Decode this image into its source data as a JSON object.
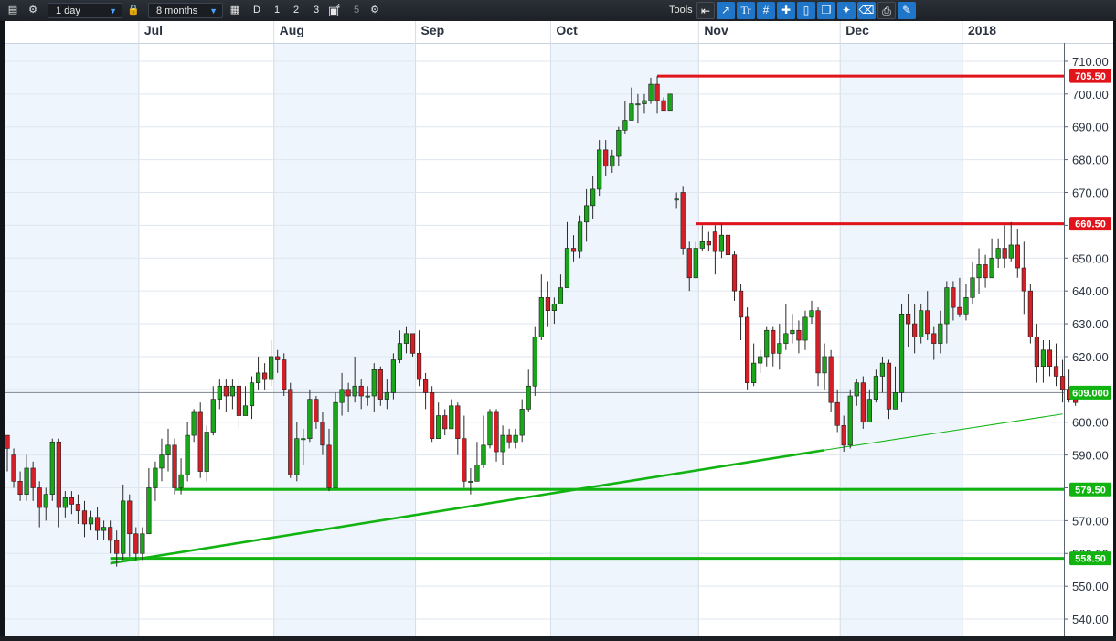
{
  "toolbar": {
    "interval": "1 day",
    "range": "8 months",
    "period_d": "D",
    "n1": "1",
    "n2": "2",
    "n3": "3",
    "n4_badge": "4",
    "n5": "5",
    "tools_label": "Tools",
    "tools_text_icon": "Tr"
  },
  "colors": {
    "up": "#1aa51a",
    "down": "#d31f26",
    "support": "#10b310",
    "resistance": "#e0141a",
    "shade": "#eef5fd",
    "grid": "#dfe6ee",
    "accent": "#1f76c8"
  },
  "chart_data": {
    "type": "candlestick",
    "ylim": [
      535,
      715
    ],
    "y_ticks": [
      540,
      550,
      560,
      570,
      580,
      590,
      600,
      610,
      620,
      630,
      640,
      650,
      660,
      670,
      680,
      690,
      700,
      710
    ],
    "x_labels": [
      {
        "label": "Jul",
        "index": 21
      },
      {
        "label": "Aug",
        "index": 42
      },
      {
        "label": "Sep",
        "index": 64
      },
      {
        "label": "Oct",
        "index": 85
      },
      {
        "label": "Nov",
        "index": 108
      },
      {
        "label": "Dec",
        "index": 130
      },
      {
        "label": "2018",
        "index": 149
      }
    ],
    "horizontal_levels": [
      {
        "label": "705.50",
        "value": 705.5,
        "from_index": 101,
        "kind": "resistance"
      },
      {
        "label": "660.50",
        "value": 660.5,
        "from_index": 107,
        "kind": "resistance"
      },
      {
        "label": "579.50",
        "value": 579.5,
        "from_index": 26,
        "kind": "support"
      },
      {
        "label": "558.50",
        "value": 558.5,
        "from_index": 16,
        "kind": "support"
      }
    ],
    "last_price": {
      "label": "609.000",
      "value": 609.0
    },
    "trendlines": [
      {
        "from": [
          16,
          557
        ],
        "to": [
          127,
          591.5
        ],
        "weight": "thick"
      },
      {
        "from": [
          127,
          591.5
        ],
        "to": [
          164,
          602.5
        ],
        "weight": "thin"
      }
    ],
    "candles": [
      [
        596,
        592,
        595,
        585
      ],
      [
        590,
        582,
        592,
        580
      ],
      [
        582,
        578,
        585,
        576
      ],
      [
        578,
        586,
        590,
        576
      ],
      [
        586,
        580,
        588,
        576
      ],
      [
        580,
        574,
        582,
        568
      ],
      [
        574,
        578,
        580,
        570
      ],
      [
        578,
        594,
        595,
        576
      ],
      [
        594,
        574,
        595,
        568
      ],
      [
        574,
        577,
        579,
        571
      ],
      [
        577,
        575,
        579,
        572
      ],
      [
        575,
        573,
        578,
        569
      ],
      [
        573,
        569,
        576,
        565
      ],
      [
        569,
        571,
        573,
        567
      ],
      [
        571,
        567,
        574,
        564
      ],
      [
        567,
        568,
        570,
        564
      ],
      [
        568,
        564,
        570,
        560
      ],
      [
        564,
        560,
        567,
        556
      ],
      [
        560,
        576,
        581,
        558
      ],
      [
        576,
        566,
        578,
        559
      ],
      [
        566,
        560,
        568,
        558
      ],
      [
        560,
        566,
        568,
        558
      ],
      [
        566,
        580,
        586,
        575
      ],
      [
        580,
        586,
        588,
        576
      ],
      [
        586,
        590,
        595,
        582
      ],
      [
        590,
        593,
        598,
        585
      ],
      [
        593,
        580,
        595,
        578
      ],
      [
        580,
        584,
        589,
        578
      ],
      [
        584,
        596,
        600,
        582
      ],
      [
        596,
        603,
        604,
        594
      ],
      [
        603,
        585,
        606,
        583
      ],
      [
        585,
        597,
        599,
        582
      ],
      [
        597,
        607,
        611,
        596
      ],
      [
        607,
        611,
        613,
        604
      ],
      [
        611,
        608,
        613,
        603
      ],
      [
        608,
        611,
        613,
        604
      ],
      [
        611,
        602,
        613,
        598
      ],
      [
        602,
        605,
        611,
        603
      ],
      [
        605,
        612,
        614,
        601
      ],
      [
        612,
        615,
        620,
        610
      ],
      [
        615,
        613,
        618,
        610
      ],
      [
        613,
        620,
        625,
        611
      ],
      [
        620,
        619,
        622,
        615
      ],
      [
        619,
        610,
        621,
        608
      ],
      [
        610,
        584,
        612,
        583
      ],
      [
        584,
        595,
        600,
        582
      ],
      [
        595,
        595,
        598,
        587
      ],
      [
        595,
        607,
        610,
        594
      ],
      [
        607,
        600,
        608,
        598
      ],
      [
        600,
        593,
        603,
        590
      ],
      [
        593,
        580,
        598,
        579
      ],
      [
        580,
        606,
        609,
        598
      ],
      [
        606,
        610,
        615,
        602
      ],
      [
        610,
        608,
        612,
        603
      ],
      [
        608,
        611,
        620,
        606
      ],
      [
        611,
        608,
        613,
        604
      ],
      [
        608,
        608,
        611,
        605
      ],
      [
        608,
        616,
        618,
        603
      ],
      [
        616,
        607,
        617,
        605
      ],
      [
        607,
        609,
        613,
        604
      ],
      [
        609,
        619,
        621,
        607
      ],
      [
        619,
        624,
        628,
        618
      ],
      [
        624,
        627,
        629,
        621
      ],
      [
        627,
        621,
        626,
        620
      ],
      [
        621,
        613,
        628,
        611
      ],
      [
        613,
        609,
        615,
        604
      ],
      [
        609,
        595,
        611,
        594
      ],
      [
        595,
        602,
        606,
        597
      ],
      [
        602,
        598,
        604,
        596
      ],
      [
        598,
        605,
        607,
        600
      ],
      [
        605,
        595,
        606,
        590
      ],
      [
        595,
        582,
        602,
        580
      ],
      [
        582,
        582,
        586,
        578
      ],
      [
        582,
        587,
        594,
        582
      ],
      [
        587,
        593,
        602,
        586
      ],
      [
        593,
        603,
        604,
        592
      ],
      [
        603,
        591,
        604,
        588
      ],
      [
        591,
        596,
        599,
        587
      ],
      [
        596,
        594,
        598,
        592
      ],
      [
        594,
        596,
        598,
        592
      ],
      [
        596,
        604,
        607,
        594
      ],
      [
        604,
        611,
        616,
        603
      ],
      [
        611,
        626,
        629,
        608
      ],
      [
        626,
        638,
        645,
        625
      ],
      [
        638,
        634,
        643,
        629
      ],
      [
        634,
        636,
        638,
        630
      ],
      [
        636,
        641,
        645,
        637
      ],
      [
        641,
        653,
        661,
        641
      ],
      [
        653,
        652,
        657,
        649
      ],
      [
        652,
        661,
        663,
        650
      ],
      [
        661,
        666,
        671,
        655
      ],
      [
        666,
        671,
        675,
        662
      ],
      [
        671,
        683,
        686,
        669
      ],
      [
        683,
        678,
        686,
        675
      ],
      [
        678,
        681,
        683,
        676
      ],
      [
        681,
        689,
        690,
        678
      ],
      [
        689,
        692,
        698,
        688
      ],
      [
        692,
        697,
        702,
        692
      ],
      [
        697,
        697,
        700,
        691
      ],
      [
        697,
        698,
        700,
        694
      ],
      [
        698,
        703,
        705,
        697
      ],
      [
        703,
        698,
        705.5,
        694
      ],
      [
        698,
        695,
        699,
        695
      ],
      [
        695,
        700,
        700,
        697
      ],
      [
        668,
        668,
        670,
        665
      ],
      [
        670,
        653,
        672,
        651
      ],
      [
        653,
        644,
        655,
        640
      ],
      [
        644,
        653,
        655,
        647
      ],
      [
        653,
        655,
        660,
        652
      ],
      [
        655,
        654,
        658,
        652
      ],
      [
        658,
        652,
        660,
        645
      ],
      [
        652,
        657,
        660.5,
        650
      ],
      [
        657,
        651,
        661,
        648
      ],
      [
        651,
        640,
        652,
        637
      ],
      [
        640,
        632,
        642,
        625
      ],
      [
        632,
        612,
        635,
        610
      ],
      [
        612,
        618,
        624,
        611
      ],
      [
        618,
        620,
        622,
        615
      ],
      [
        620,
        628,
        629,
        617
      ],
      [
        628,
        621,
        629,
        617
      ],
      [
        621,
        624,
        630,
        616
      ],
      [
        624,
        627,
        636,
        622
      ],
      [
        627,
        628,
        633,
        624
      ],
      [
        628,
        625,
        631,
        621
      ],
      [
        625,
        632,
        634,
        622
      ],
      [
        632,
        634,
        637,
        630
      ],
      [
        634,
        615,
        635,
        611
      ],
      [
        615,
        620,
        624,
        610
      ],
      [
        620,
        606,
        622,
        603
      ],
      [
        606,
        599,
        610,
        597
      ],
      [
        599,
        593,
        602,
        591
      ],
      [
        593,
        608,
        610,
        592
      ],
      [
        608,
        612,
        613,
        605
      ],
      [
        612,
        600,
        614,
        598
      ],
      [
        600,
        607,
        610,
        604
      ],
      [
        607,
        614,
        616,
        606
      ],
      [
        614,
        618,
        620,
        609
      ],
      [
        618,
        604,
        619,
        601
      ],
      [
        604,
        609,
        617,
        604
      ],
      [
        609,
        633,
        636,
        606
      ],
      [
        633,
        630,
        639,
        623
      ],
      [
        630,
        626,
        636,
        621
      ],
      [
        626,
        634,
        636,
        624
      ],
      [
        634,
        627,
        640,
        625
      ],
      [
        627,
        624,
        629,
        619
      ],
      [
        624,
        630,
        634,
        621
      ],
      [
        630,
        641,
        643,
        624
      ],
      [
        641,
        635,
        643,
        631
      ],
      [
        635,
        633,
        644,
        632
      ],
      [
        633,
        638,
        642,
        631
      ],
      [
        638,
        644,
        649,
        636
      ],
      [
        644,
        648,
        653,
        639
      ],
      [
        648,
        644,
        651,
        641
      ],
      [
        644,
        650,
        656,
        644
      ],
      [
        650,
        653,
        656,
        647
      ],
      [
        653,
        650,
        660,
        647
      ],
      [
        650,
        654,
        661,
        649
      ],
      [
        654,
        647,
        659,
        644
      ],
      [
        647,
        640,
        655,
        633
      ],
      [
        640,
        626,
        642,
        624
      ],
      [
        626,
        617,
        630,
        612
      ],
      [
        617,
        622,
        625,
        612
      ],
      [
        622,
        617,
        625,
        614
      ],
      [
        617,
        614,
        624,
        611
      ],
      [
        614,
        610,
        619,
        606
      ],
      [
        610,
        607,
        616,
        606
      ],
      [
        607,
        606,
        610,
        605
      ]
    ]
  }
}
